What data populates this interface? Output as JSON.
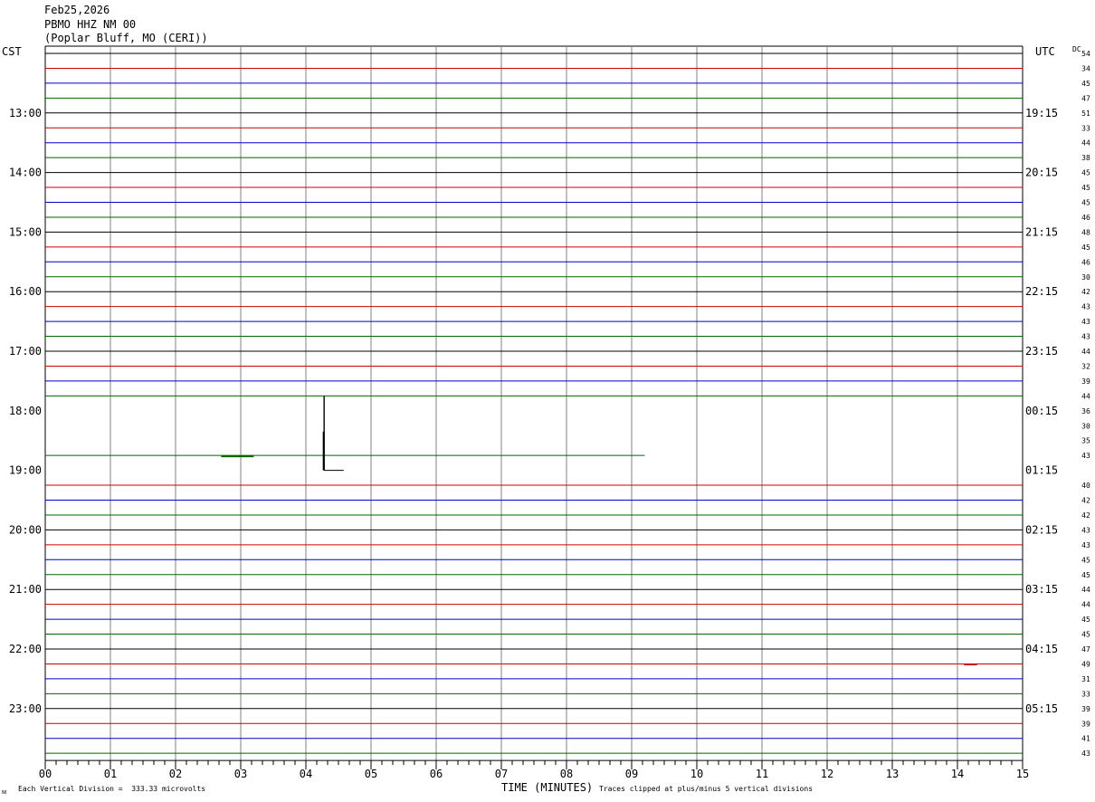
{
  "header": {
    "date": "Feb25,2026",
    "station": "PBMO HHZ NM 00",
    "location": "(Poplar Bluff, MO (CERI))"
  },
  "left_zone": "CST",
  "right_zone": "UTC",
  "dc_label": "DC",
  "footer": {
    "scale": "Each Vertical Division =  333.33 microvolts",
    "clip": "Traces clipped at plus/minus 5 vertical divisions",
    "corner_mark": "ᴍ"
  },
  "chart_data": {
    "type": "line",
    "xlabel": "TIME (MINUTES)",
    "x_range": [
      0,
      15
    ],
    "x_ticks": [
      "00",
      "01",
      "02",
      "03",
      "04",
      "05",
      "06",
      "07",
      "08",
      "09",
      "10",
      "11",
      "12",
      "13",
      "14",
      "15"
    ],
    "rows_per_hour": 4,
    "trace_colors": [
      "#000000",
      "#cc0000",
      "#0000cc",
      "#006600"
    ],
    "grid_color": "#808080",
    "grid": true,
    "left_hour_labels": [
      {
        "row": 4,
        "label": "13:00"
      },
      {
        "row": 8,
        "label": "14:00"
      },
      {
        "row": 12,
        "label": "15:00"
      },
      {
        "row": 16,
        "label": "16:00"
      },
      {
        "row": 20,
        "label": "17:00"
      },
      {
        "row": 24,
        "label": "18:00"
      },
      {
        "row": 28,
        "label": "19:00"
      },
      {
        "row": 32,
        "label": "20:00"
      },
      {
        "row": 36,
        "label": "21:00"
      },
      {
        "row": 40,
        "label": "22:00"
      },
      {
        "row": 44,
        "label": "23:00"
      }
    ],
    "right_hour_labels": [
      {
        "row": 4,
        "label": "19:15"
      },
      {
        "row": 8,
        "label": "20:15"
      },
      {
        "row": 12,
        "label": "21:15"
      },
      {
        "row": 16,
        "label": "22:15"
      },
      {
        "row": 20,
        "label": "23:15"
      },
      {
        "row": 24,
        "label": "00:15"
      },
      {
        "row": 28,
        "label": "01:15"
      },
      {
        "row": 32,
        "label": "02:15"
      },
      {
        "row": 36,
        "label": "03:15"
      },
      {
        "row": 40,
        "label": "04:15"
      },
      {
        "row": 44,
        "label": "05:15"
      }
    ],
    "dc_values": [
      "54",
      "34",
      "45",
      "47",
      "51",
      "33",
      "44",
      "38",
      "45",
      "45",
      "45",
      "46",
      "48",
      "45",
      "46",
      "30",
      "42",
      "43",
      "43",
      "43",
      "44",
      "32",
      "39",
      "44",
      "36",
      "30",
      "35",
      "43",
      "",
      "40",
      "42",
      "42",
      "43",
      "43",
      "45",
      "45",
      "44",
      "44",
      "45",
      "45",
      "47",
      "49",
      "31",
      "33",
      "39",
      "39",
      "41",
      "43"
    ],
    "rows": [
      {
        "row": 0
      },
      {
        "row": 1
      },
      {
        "row": 2
      },
      {
        "row": 3
      },
      {
        "row": 4
      },
      {
        "row": 5
      },
      {
        "row": 6
      },
      {
        "row": 7
      },
      {
        "row": 8
      },
      {
        "row": 9
      },
      {
        "row": 10
      },
      {
        "row": 11
      },
      {
        "row": 12
      },
      {
        "row": 13
      },
      {
        "row": 14
      },
      {
        "row": 15
      },
      {
        "row": 16
      },
      {
        "row": 17
      },
      {
        "row": 18
      },
      {
        "row": 19
      },
      {
        "row": 20
      },
      {
        "row": 21
      },
      {
        "row": 22
      },
      {
        "row": 23,
        "x_end": 15,
        "note_right_tick": true
      },
      {
        "row": 24,
        "x_end": 0
      },
      {
        "row": 25,
        "x_end": 0
      },
      {
        "row": 26,
        "x_end": 0
      },
      {
        "row": 27,
        "x_start": 0,
        "x_end": 9.2
      },
      {
        "row": 28,
        "x_start": 4.28,
        "x_end": 4.58
      },
      {
        "row": 29
      },
      {
        "row": 30
      },
      {
        "row": 31
      },
      {
        "row": 32
      },
      {
        "row": 33
      },
      {
        "row": 34
      },
      {
        "row": 35
      },
      {
        "row": 36
      },
      {
        "row": 37
      },
      {
        "row": 38
      },
      {
        "row": 39
      },
      {
        "row": 40
      },
      {
        "row": 41
      },
      {
        "row": 42
      },
      {
        "row": 43
      },
      {
        "row": 44
      },
      {
        "row": 45
      },
      {
        "row": 46
      },
      {
        "row": 47
      }
    ],
    "spike": {
      "row": 28,
      "x": 4.28,
      "amplitude_divisions": 5
    }
  }
}
